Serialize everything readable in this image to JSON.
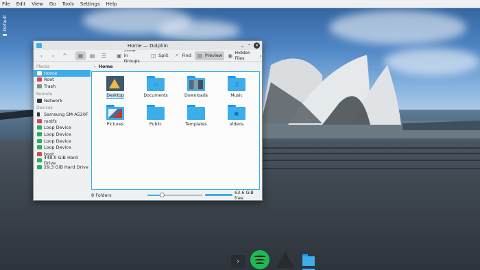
{
  "menubar": {
    "items": [
      "File",
      "Edit",
      "View",
      "Go",
      "Tools",
      "Settings",
      "Help"
    ]
  },
  "panel": {
    "label": "Default"
  },
  "window": {
    "title": "Home — Dolphin",
    "toolbar": {
      "show_in_groups": "Show in Groups",
      "split": "Split",
      "find": "Find",
      "preview": "Preview",
      "hidden_files": "Hidden Files"
    },
    "sidebar": {
      "places_header": "Places",
      "places": [
        "Home",
        "Root",
        "Trash"
      ],
      "remote_header": "Remote",
      "remote": [
        "Network"
      ],
      "devices_header": "Devices",
      "devices": [
        "Samsung SM-A520F",
        "rootfs",
        "Loop Device",
        "Loop Device",
        "Loop Device",
        "Loop Device",
        "boot",
        "448.0 GiB Hard Drive",
        "29.3 GiB Hard Drive"
      ]
    },
    "breadcrumb": "Home",
    "folders": [
      "Desktop",
      "Documents",
      "Downloads",
      "Music",
      "Pictures",
      "Public",
      "Templates",
      "Videos"
    ],
    "status": {
      "count": "8 Folders",
      "free": "63.6 GiB free"
    }
  },
  "colors": {
    "accent": "#3daee9",
    "folder_dark": "#1d99f3",
    "window_bg": "#eff0f1"
  }
}
